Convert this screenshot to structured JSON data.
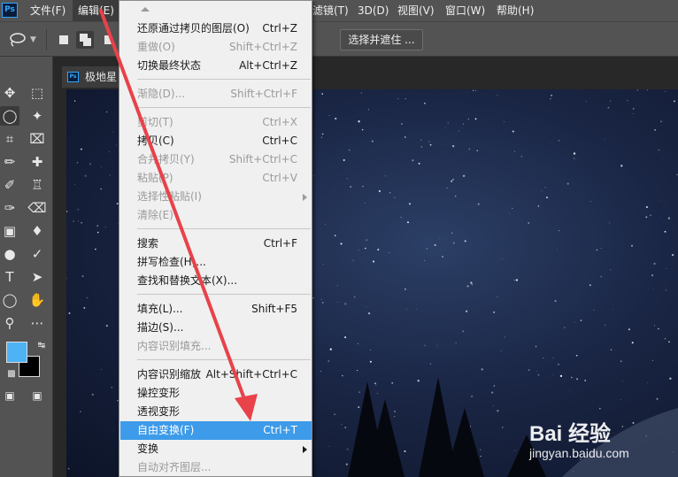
{
  "app": {
    "logo_text": "Ps"
  },
  "menubar": {
    "items": [
      {
        "label": "文件(F)"
      },
      {
        "label": "编辑(E)"
      },
      {
        "label": "滤镜(T)"
      },
      {
        "label": "3D(D)"
      },
      {
        "label": "视图(V)"
      },
      {
        "label": "窗口(W)"
      },
      {
        "label": "帮助(H)"
      }
    ]
  },
  "options_bar": {
    "select_and_mask": "选择并遮住 ..."
  },
  "document": {
    "tab_title": "极地星"
  },
  "colors": {
    "foreground": "#4db3f5",
    "background": "#000000",
    "menu_highlight": "#3d9be9",
    "annotation_arrow": "#e8424a"
  },
  "edit_menu": {
    "items": [
      {
        "label": "还原通过拷贝的图层(O)",
        "shortcut": "Ctrl+Z"
      },
      {
        "label": "重做(O)",
        "shortcut": "Shift+Ctrl+Z"
      },
      {
        "label": "切换最终状态",
        "shortcut": "Alt+Ctrl+Z"
      },
      {
        "label": "渐隐(D)...",
        "shortcut": "Shift+Ctrl+F"
      },
      {
        "label": "剪切(T)",
        "shortcut": "Ctrl+X"
      },
      {
        "label": "拷贝(C)",
        "shortcut": "Ctrl+C"
      },
      {
        "label": "合并拷贝(Y)",
        "shortcut": "Shift+Ctrl+C"
      },
      {
        "label": "粘贴(P)",
        "shortcut": "Ctrl+V"
      },
      {
        "label": "选择性粘贴(I)",
        "shortcut": ""
      },
      {
        "label": "清除(E)",
        "shortcut": ""
      },
      {
        "label": "搜索",
        "shortcut": "Ctrl+F"
      },
      {
        "label": "拼写检查(H)...",
        "shortcut": ""
      },
      {
        "label": "查找和替换文本(X)...",
        "shortcut": ""
      },
      {
        "label": "填充(L)...",
        "shortcut": "Shift+F5"
      },
      {
        "label": "描边(S)...",
        "shortcut": ""
      },
      {
        "label": "内容识别填充...",
        "shortcut": ""
      },
      {
        "label": "内容识别缩放",
        "shortcut": "Alt+Shift+Ctrl+C"
      },
      {
        "label": "操控变形",
        "shortcut": ""
      },
      {
        "label": "透视变形",
        "shortcut": ""
      },
      {
        "label": "自由变换(F)",
        "shortcut": "Ctrl+T"
      },
      {
        "label": "变换",
        "shortcut": ""
      },
      {
        "label": "自动对齐图层...",
        "shortcut": ""
      }
    ]
  },
  "watermark": {
    "brand": "Bai 经验",
    "url": "jingyan.baidu.com"
  }
}
